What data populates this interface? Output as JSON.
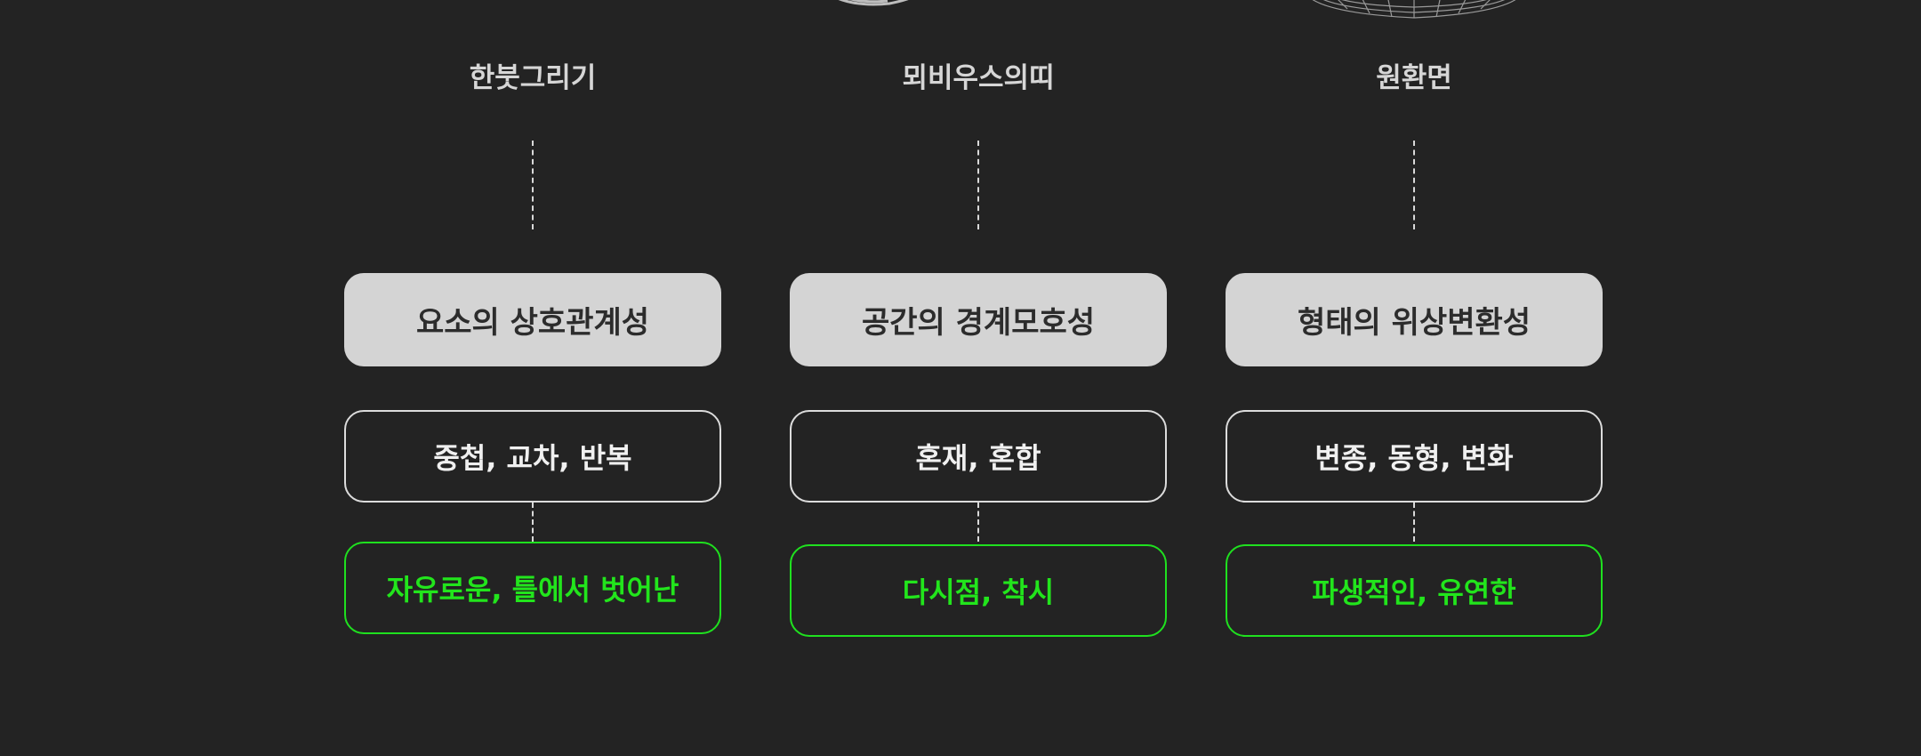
{
  "columns": [
    {
      "topic": "한붓그리기",
      "concept": "요소의 상호관계성",
      "keywords": "중첩, 교차, 반복",
      "result": "자유로운, 틀에서 벗어난"
    },
    {
      "topic": "뫼비우스의띠",
      "concept": "공간의 경계모호성",
      "keywords": "혼재, 혼합",
      "result": "다시점, 착시"
    },
    {
      "topic": "원환면",
      "concept": "형태의 위상변환성",
      "keywords": "변종, 동형, 변화",
      "result": "파생적인, 유연한"
    }
  ],
  "colors": {
    "background": "#232323",
    "concept_fill": "#d4d4d4",
    "accent_green": "#22e51c",
    "outline": "#dcdcdc"
  }
}
